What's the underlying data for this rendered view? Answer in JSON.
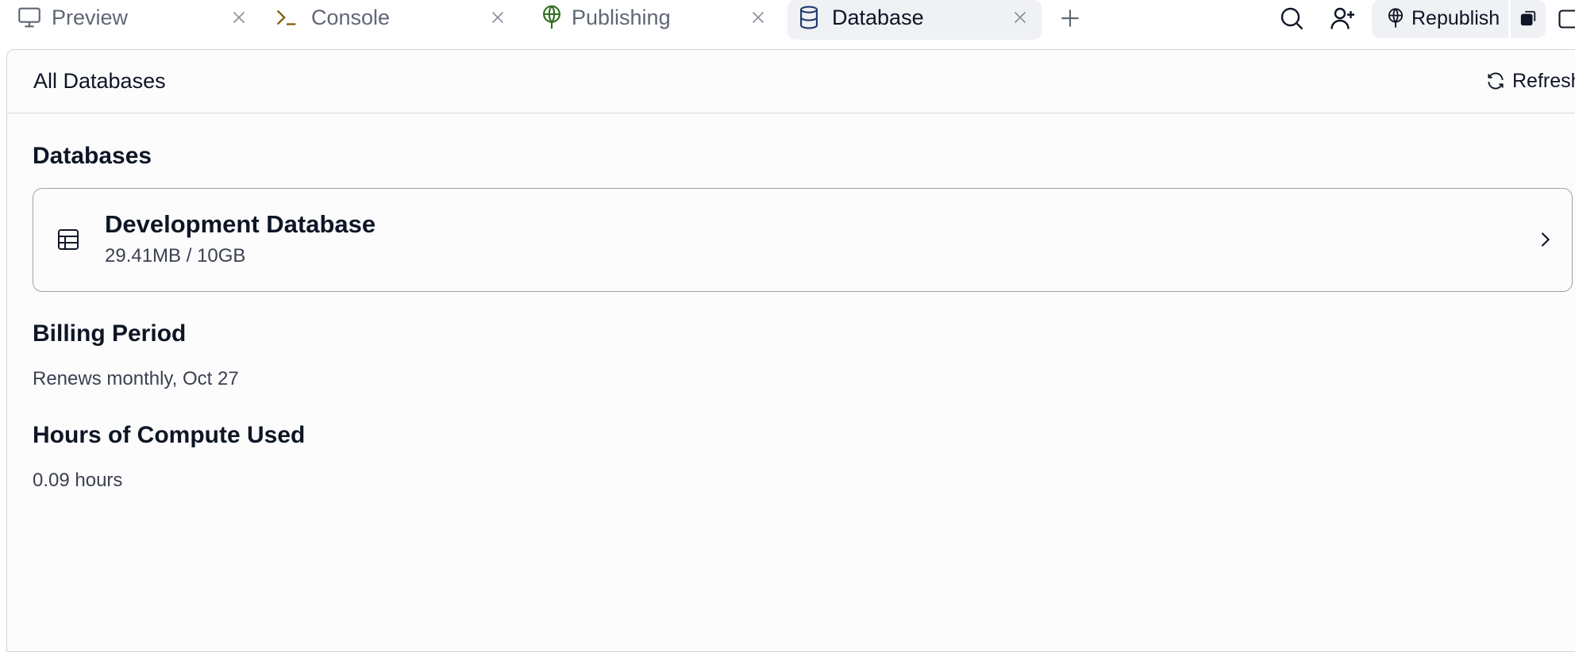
{
  "tabs": [
    {
      "label": "Preview",
      "icon": "monitor-icon",
      "active": false
    },
    {
      "label": "Console",
      "icon": "terminal-icon",
      "active": false
    },
    {
      "label": "Publishing",
      "icon": "publishing-icon",
      "active": false
    },
    {
      "label": "Database",
      "icon": "database-icon",
      "active": true
    }
  ],
  "topbar": {
    "add_tab_icon": "plus-icon",
    "search_icon": "search-icon",
    "invite_icon": "user-plus-icon",
    "republish_label": "Republish",
    "republish_icon": "publishing-icon",
    "split_icon": "layers-icon"
  },
  "header": {
    "title": "All Databases",
    "refresh_label": "Refresh"
  },
  "databases": {
    "heading": "Databases",
    "items": [
      {
        "name": "Development Database",
        "usage": "29.41MB / 10GB"
      }
    ]
  },
  "billing": {
    "heading": "Billing Period",
    "text": "Renews monthly, Oct 27"
  },
  "compute": {
    "heading": "Hours of Compute Used",
    "text": "0.09 hours"
  },
  "colors": {
    "accent_green": "#2f6d1f",
    "console_olive": "#7a5c00",
    "database_blue": "#1f3a6d",
    "border": "#d4d7dc",
    "card_border": "#9da2ad"
  }
}
